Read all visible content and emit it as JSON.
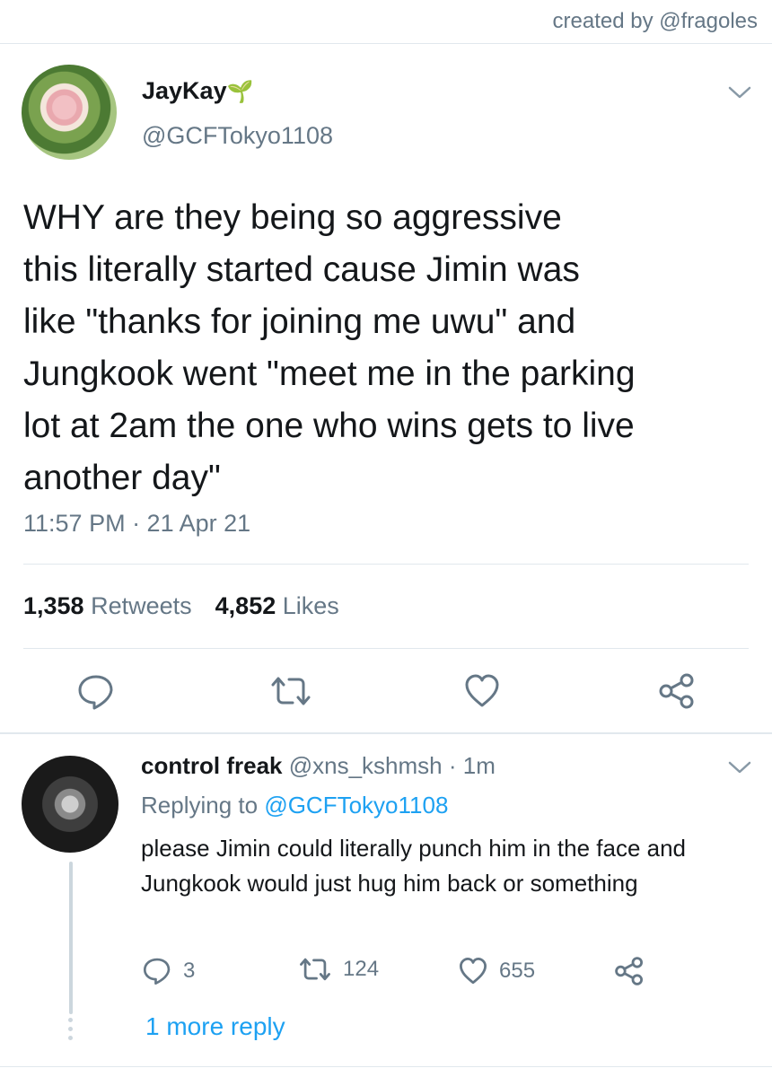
{
  "credit": "created by @fragoles",
  "tweet": {
    "display_name": "JayKay",
    "name_emoji": "🌱",
    "handle": "@GCFTokyo1108",
    "text": "WHY are they being so aggressive\nthis literally started cause Jimin was\nlike \"thanks for joining me uwu\" and\nJungkook went \"meet me in the parking\nlot at 2am the one who wins gets to live\nanother day\"",
    "timestamp": "11:57 PM · 21 Apr 21",
    "retweets_count": "1,358",
    "retweets_label": "Retweets",
    "likes_count": "4,852",
    "likes_label": "Likes"
  },
  "reply": {
    "display_name": "control freak",
    "handle": "@xns_kshmsh",
    "age": "· 1m",
    "replying_prefix": "Replying to",
    "replying_handle": "@GCFTokyo1108",
    "text": "please Jimin could literally punch him in the face and Jungkook would just hug him back or something",
    "reply_count": "3",
    "retweet_count": "124",
    "like_count": "655",
    "more_replies": "1 more reply"
  },
  "icons": {
    "actions": [
      "reply-icon",
      "retweet-icon",
      "like-icon",
      "share-icon"
    ],
    "menu": "chevron-down-icon"
  },
  "colors": {
    "text": "#14171a",
    "secondary": "#657786",
    "accent": "#1da1f2",
    "divider": "#e1e8ed"
  }
}
